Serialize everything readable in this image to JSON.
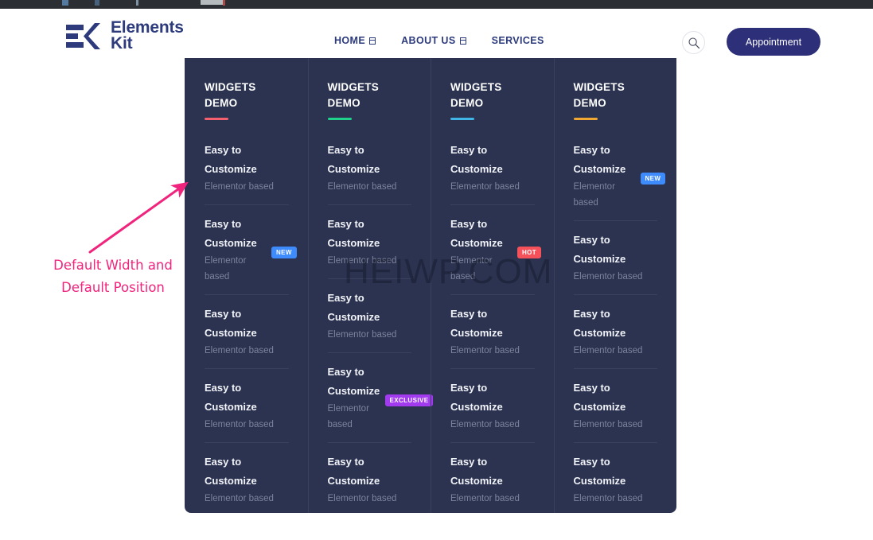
{
  "browser": {
    "chrome_bar": "browser-top-chrome"
  },
  "header": {
    "logo": {
      "icon": "elementskit-logo-icon",
      "line1": "Elements",
      "line2": "Kit"
    },
    "nav": [
      {
        "label": "HOME",
        "has_caret": true
      },
      {
        "label": "ABOUT US",
        "has_caret": true
      },
      {
        "label": "SERVICES",
        "has_caret": false
      }
    ],
    "search_icon": "search-icon",
    "appointment_label": "Appointment"
  },
  "mega_menu": {
    "title_line1": "WIDGETS",
    "title_line2": "DEMO",
    "columns": [
      {
        "accent": "#f4606e",
        "items": [
          {
            "title_line1": "Easy to",
            "title_line2": "Customize",
            "subtitle": "Elementor based",
            "badge": null
          },
          {
            "title_line1": "Easy to",
            "title_line2": "Customize",
            "subtitle": "Elementor based",
            "badge": "NEW",
            "badge_type": "b-new"
          },
          {
            "title_line1": "Easy to",
            "title_line2": "Customize",
            "subtitle": "Elementor based",
            "badge": null
          },
          {
            "title_line1": "Easy to",
            "title_line2": "Customize",
            "subtitle": "Elementor based",
            "badge": null
          },
          {
            "title_line1": "Easy to",
            "title_line2": "Customize",
            "subtitle": "Elementor based",
            "badge": null
          }
        ]
      },
      {
        "accent": "#1fd18a",
        "items": [
          {
            "title_line1": "Easy to",
            "title_line2": "Customize",
            "subtitle": "Elementor based",
            "badge": null
          },
          {
            "title_line1": "Easy to",
            "title_line2": "Customize",
            "subtitle": "Elementor based",
            "badge": null
          },
          {
            "title_line1": "Easy to",
            "title_line2": "Customize",
            "subtitle": "Elementor based",
            "badge": null
          },
          {
            "title_line1": "Easy to",
            "title_line2": "Customize",
            "subtitle": "Elementor based",
            "badge": "EXCLUSIVE",
            "badge_type": "b-exclusive"
          },
          {
            "title_line1": "Easy to",
            "title_line2": "Customize",
            "subtitle": "Elementor based",
            "badge": null
          }
        ]
      },
      {
        "accent": "#41b6e6",
        "items": [
          {
            "title_line1": "Easy to",
            "title_line2": "Customize",
            "subtitle": "Elementor based",
            "badge": null
          },
          {
            "title_line1": "Easy to",
            "title_line2": "Customize",
            "subtitle": "Elementor based",
            "badge": "HOT",
            "badge_type": "b-hot"
          },
          {
            "title_line1": "Easy to",
            "title_line2": "Customize",
            "subtitle": "Elementor based",
            "badge": null
          },
          {
            "title_line1": "Easy to",
            "title_line2": "Customize",
            "subtitle": "Elementor based",
            "badge": null
          },
          {
            "title_line1": "Easy to",
            "title_line2": "Customize",
            "subtitle": "Elementor based",
            "badge": null
          }
        ]
      },
      {
        "accent": "#f0a832",
        "items": [
          {
            "title_line1": "Easy to",
            "title_line2": "Customize",
            "subtitle": "Elementor based",
            "badge": "NEW",
            "badge_type": "b-new"
          },
          {
            "title_line1": "Easy to",
            "title_line2": "Customize",
            "subtitle": "Elementor based",
            "badge": null
          },
          {
            "title_line1": "Easy to",
            "title_line2": "Customize",
            "subtitle": "Elementor based",
            "badge": null
          },
          {
            "title_line1": "Easy to",
            "title_line2": "Customize",
            "subtitle": "Elementor based",
            "badge": null
          },
          {
            "title_line1": "Easy to",
            "title_line2": "Customize",
            "subtitle": "Elementor based",
            "badge": null
          }
        ]
      }
    ]
  },
  "watermark": {
    "text": "HEIWP.COM"
  },
  "annotation": {
    "line1": "Default Width and",
    "line2": "Default Position",
    "color": "#f0247c",
    "arrow": "annotation-arrow-icon"
  }
}
